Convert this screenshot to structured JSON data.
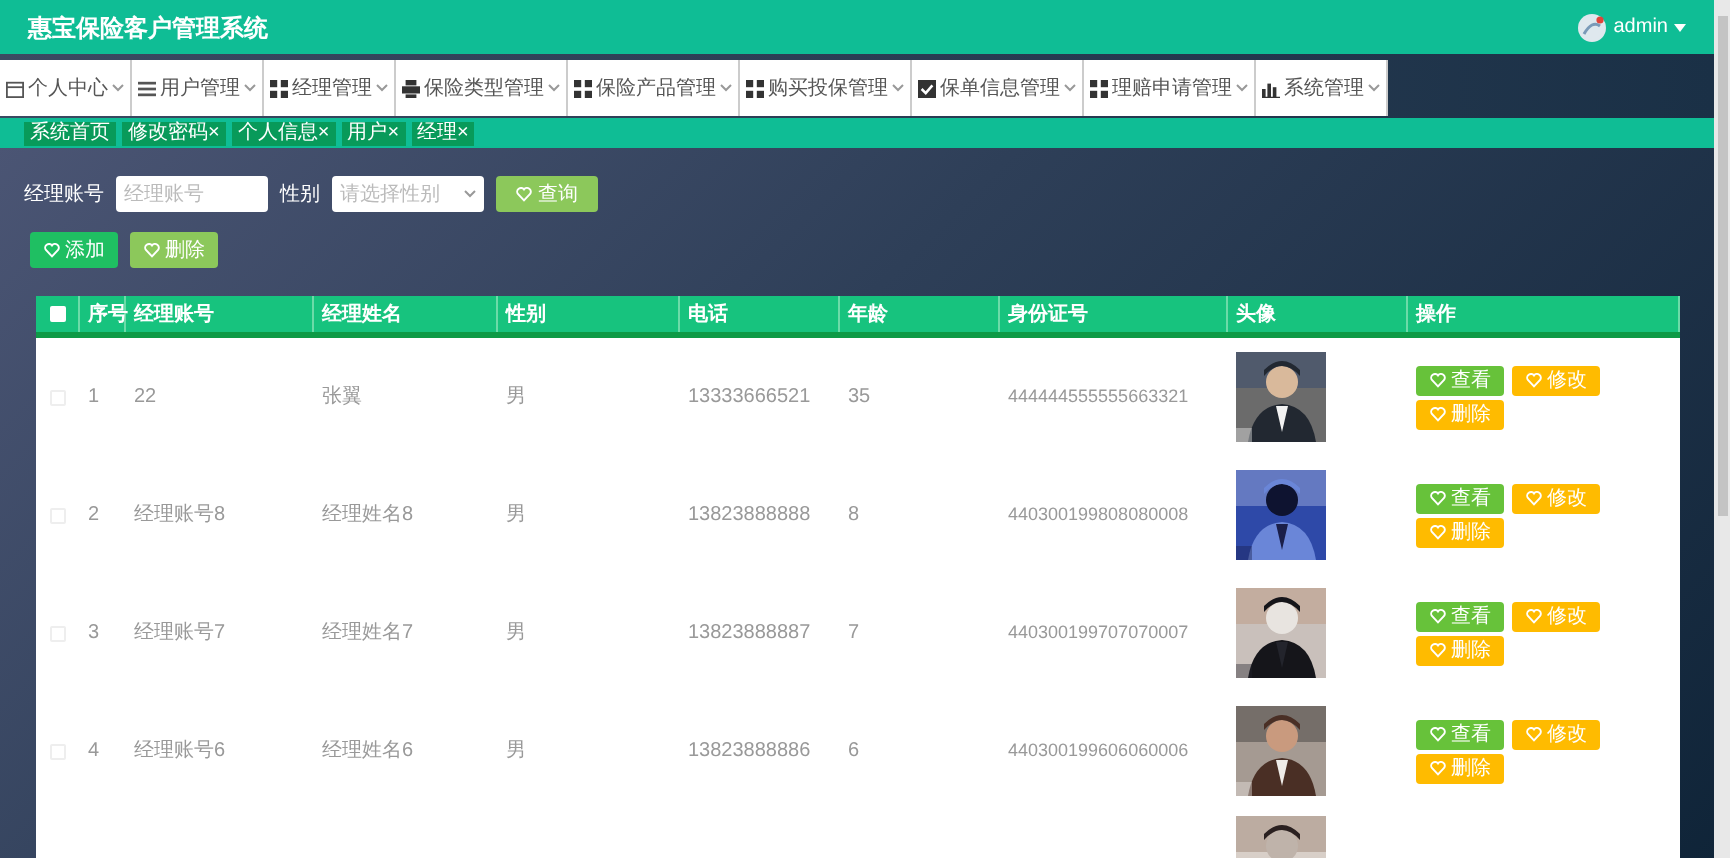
{
  "header": {
    "title": "惠宝保险客户管理系统",
    "user": "admin"
  },
  "menu": [
    {
      "label": "个人中心",
      "kind": "calendar"
    },
    {
      "label": "用户管理",
      "kind": "list"
    },
    {
      "label": "经理管理",
      "kind": "grid"
    },
    {
      "label": "保险类型管理",
      "kind": "printer"
    },
    {
      "label": "保险产品管理",
      "kind": "grid"
    },
    {
      "label": "购买投保管理",
      "kind": "grid"
    },
    {
      "label": "保单信息管理",
      "kind": "check"
    },
    {
      "label": "理赔申请管理",
      "kind": "grid"
    },
    {
      "label": "系统管理",
      "kind": "chart"
    }
  ],
  "tags": [
    {
      "label": "系统首页"
    },
    {
      "label": "修改密码",
      "close": "×"
    },
    {
      "label": "个人信息",
      "close": "×"
    },
    {
      "label": "用户",
      "close": "×"
    },
    {
      "label": "经理",
      "close": "×"
    }
  ],
  "search": {
    "account_label": "经理账号",
    "account_placeholder": "经理账号",
    "gender_label": "性别",
    "gender_placeholder": "请选择性别",
    "button": "查询"
  },
  "actions": {
    "add": "添加",
    "delete": "删除"
  },
  "table": {
    "select_all": {
      "checked": false
    },
    "columns": [
      "序号",
      "经理账号",
      "经理姓名",
      "性别",
      "电话",
      "年龄",
      "身份证号",
      "头像",
      "操作"
    ],
    "rows": [
      {
        "checked": false,
        "index": "1",
        "account": "22",
        "name": "张翼",
        "gender": "男",
        "phone": "13333666521",
        "age": "35",
        "id_number": "444444555555663321",
        "actions": {
          "view": "查看",
          "edit": "修改",
          "delete": "删除"
        }
      },
      {
        "checked": false,
        "index": "2",
        "account": "经理账号8",
        "name": "经理姓名8",
        "gender": "男",
        "phone": "13823888888",
        "age": "8",
        "id_number": "440300199808080008",
        "actions": {
          "view": "查看",
          "edit": "修改",
          "delete": "删除"
        }
      },
      {
        "checked": false,
        "index": "3",
        "account": "经理账号7",
        "name": "经理姓名7",
        "gender": "男",
        "phone": "13823888887",
        "age": "7",
        "id_number": "440300199707070007",
        "actions": {
          "view": "查看",
          "edit": "修改",
          "delete": "删除"
        }
      },
      {
        "checked": false,
        "index": "4",
        "account": "经理账号6",
        "name": "经理姓名6",
        "gender": "男",
        "phone": "13823888886",
        "age": "6",
        "id_number": "440300199606060006",
        "actions": {
          "view": "查看",
          "edit": "修改",
          "delete": "删除"
        }
      }
    ]
  }
}
